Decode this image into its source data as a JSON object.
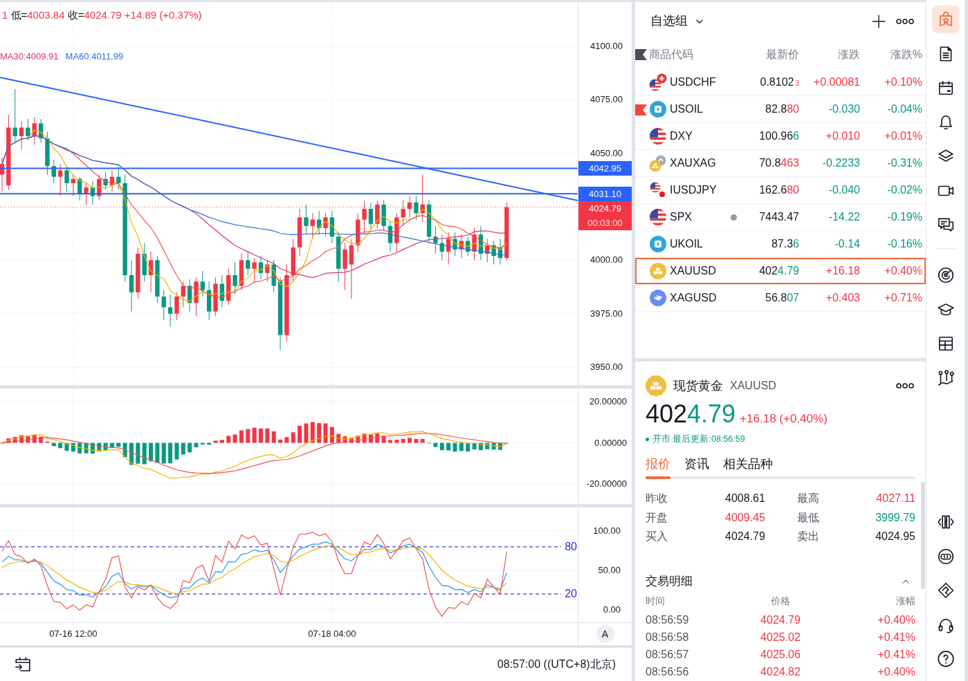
{
  "chart": {
    "ohlc_legend": {
      "color": "#f23645",
      "items": [
        {
          "value": "1"
        },
        {
          "label": "低=",
          "value": "4003.84"
        },
        {
          "label": "收=",
          "value": "4024.79"
        },
        {
          "value": "+14.89"
        },
        {
          "value": "(+0.37%)"
        }
      ]
    },
    "ma_legend": [
      {
        "text": "MA30:4009.91",
        "color": "#e0306a"
      },
      {
        "text": "MA60:4011.99",
        "color": "#2f6fd6"
      }
    ],
    "price_axis": [
      "4100.00",
      "4075.00",
      "4050.00",
      "4000.00",
      "3975.00",
      "3950.00"
    ],
    "price_tags": [
      {
        "label": "4042.95",
        "color": "#2962ff"
      },
      {
        "label": "4031.10",
        "color": "#2962ff"
      },
      {
        "label": "4024.79",
        "color": "#f23645"
      }
    ],
    "countdown": "00:03:00",
    "macd_axis": [
      "20.00000",
      "0.00000",
      "-20.00000"
    ],
    "kdj_axis": [
      "100.00",
      "50.00",
      "0.00"
    ],
    "kdj_levels": [
      "80",
      "20"
    ],
    "time_axis": [
      "07-16 12:00",
      "07-18 04:00"
    ],
    "auto_scale_button": "A",
    "status_bar": {
      "clock": "08:57:00 ((UTC+8)北京)"
    }
  },
  "watchlist": {
    "title": "自选组",
    "columns": [
      "商品代码",
      "最新价",
      "涨跌",
      "涨跌%"
    ],
    "rows": [
      {
        "symbol": "USDCHF",
        "price": "0.8102",
        "price_tail": "3",
        "tail_up": true,
        "pipette": true,
        "change": "+0.00081",
        "change_pct": "+0.10%",
        "color": "#f23645",
        "flagged": false,
        "market_closed": false,
        "selected": false
      },
      {
        "symbol": "USOIL",
        "price": "82.8",
        "price_tail": "80",
        "tail_up": true,
        "pipette": false,
        "change": "-0.030",
        "change_pct": "-0.04%",
        "color": "#089981",
        "flagged": true,
        "market_closed": false,
        "selected": false
      },
      {
        "symbol": "DXY",
        "price": "100.96",
        "price_tail": "6",
        "tail_up": false,
        "pipette": false,
        "change": "+0.010",
        "change_pct": "+0.01%",
        "color": "#f23645",
        "flagged": false,
        "market_closed": false,
        "selected": false
      },
      {
        "symbol": "XAUXAG",
        "price": "70.8",
        "price_tail": "463",
        "tail_up": true,
        "pipette": false,
        "change": "-0.2233",
        "change_pct": "-0.31%",
        "color": "#089981",
        "flagged": false,
        "market_closed": false,
        "selected": false
      },
      {
        "symbol": "IUSDJPY",
        "price": "162.6",
        "price_tail": "80",
        "tail_up": true,
        "pipette": false,
        "change": "-0.040",
        "change_pct": "-0.02%",
        "color": "#089981",
        "flagged": false,
        "market_closed": false,
        "selected": false
      },
      {
        "symbol": "SPX",
        "price": "7443.47",
        "change": "-14.22",
        "change_pct": "-0.19%",
        "color": "#089981",
        "flagged": false,
        "market_closed": true,
        "selected": false
      },
      {
        "symbol": "UKOIL",
        "price": "87.3",
        "price_tail": "6",
        "tail_up": false,
        "pipette": false,
        "change": "-0.14",
        "change_pct": "-0.16%",
        "color": "#089981",
        "flagged": false,
        "market_closed": false,
        "selected": false
      },
      {
        "symbol": "XAUUSD",
        "price": "402",
        "price_tail": "4.79",
        "tail_up": false,
        "pipette": false,
        "change": "+16.18",
        "change_pct": "+0.40%",
        "color": "#f23645",
        "flagged": false,
        "market_closed": false,
        "selected": true
      },
      {
        "symbol": "XAGUSD",
        "price": "56.8",
        "price_tail": "07",
        "tail_up": false,
        "pipette": false,
        "change": "+0.403",
        "change_pct": "+0.71%",
        "color": "#f23645",
        "flagged": false,
        "market_closed": false,
        "selected": false
      }
    ]
  },
  "detail": {
    "name": "现货黄金",
    "symbol": "XAUUSD",
    "price": "402",
    "price_tail": "4.79",
    "tail_up": false,
    "change": "+16.18 (+0.40%)",
    "color": "#f23645",
    "market_open": true,
    "status": "开市 最后更新:08:56:59",
    "tabs": [
      {
        "label": "报价",
        "selected": true
      },
      {
        "label": "资讯",
        "selected": false
      },
      {
        "label": "相关品种",
        "selected": false
      }
    ],
    "quote": [
      {
        "label": "昨收",
        "value": "4008.61",
        "color": "#131722"
      },
      {
        "label": "最高",
        "value": "4027.11",
        "color": "#f23645"
      },
      {
        "label": "开盘",
        "value": "4009.45",
        "color": "#f23645"
      },
      {
        "label": "最低",
        "value": "3999.79",
        "color": "#089981"
      },
      {
        "label": "买入",
        "value": "4024.79",
        "color": "#131722"
      },
      {
        "label": "卖出",
        "value": "4024.95",
        "color": "#131722"
      }
    ],
    "trades": {
      "title": "交易明细",
      "expanded": true,
      "columns": [
        "时间",
        "价格",
        "涨幅"
      ],
      "rows": [
        {
          "time": "08:56:59",
          "price": "4024.79",
          "change_pct": "+0.40%",
          "color": "#f23645"
        },
        {
          "time": "08:56:58",
          "price": "4025.02",
          "change_pct": "+0.41%",
          "color": "#f23645"
        },
        {
          "time": "08:56:57",
          "price": "4025.06",
          "change_pct": "+0.41%",
          "color": "#f23645"
        },
        {
          "time": "08:56:56",
          "price": "4024.82",
          "change_pct": "+0.40%",
          "color": "#f23645"
        }
      ]
    }
  },
  "side_toolbar": {
    "top": [
      {
        "selected": true
      },
      {
        "selected": false
      },
      {
        "selected": false
      },
      {
        "selected": false
      },
      {
        "selected": false
      },
      {
        "selected": false
      },
      {
        "selected": false
      }
    ],
    "middle": [
      {
        "selected": false
      },
      {
        "selected": false
      },
      {
        "selected": false
      },
      {
        "selected": false
      }
    ],
    "bottom": [
      {
        "selected": false
      },
      {
        "selected": false
      },
      {
        "selected": false
      },
      {
        "selected": false
      },
      {
        "selected": false
      }
    ]
  }
}
